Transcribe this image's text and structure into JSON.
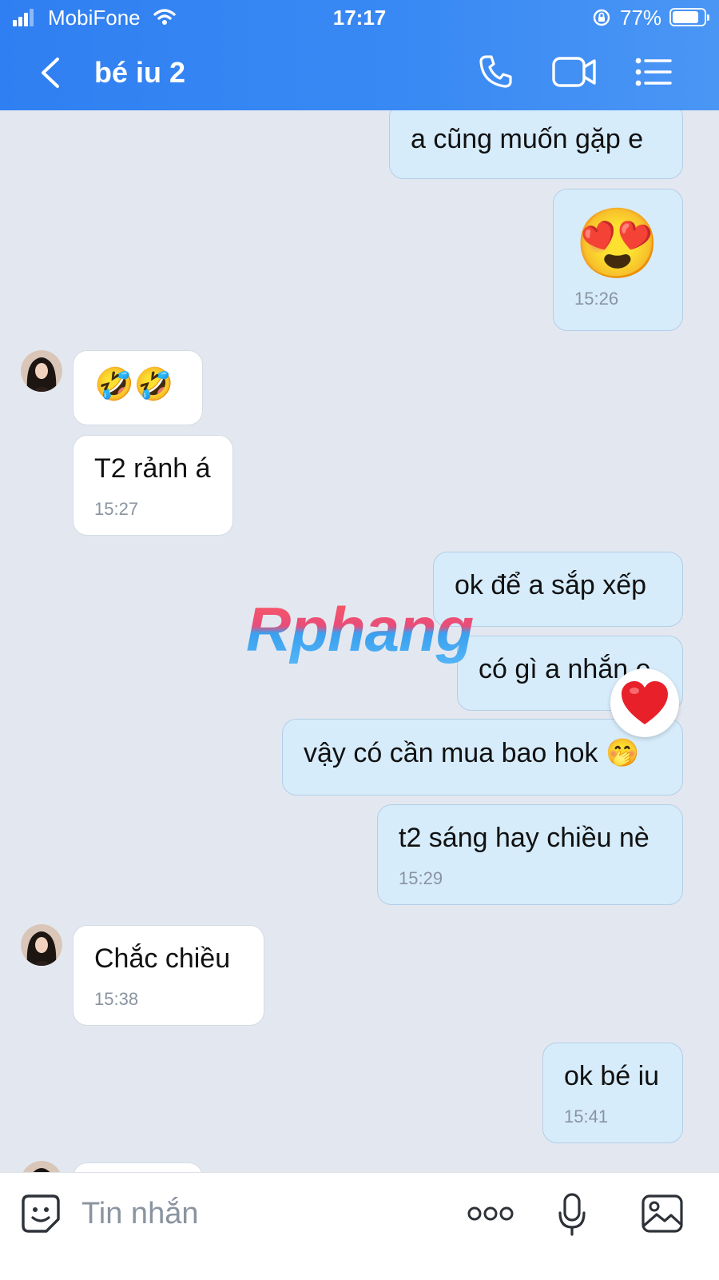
{
  "status_bar": {
    "carrier": "MobiFone",
    "time": "17:17",
    "battery": "77%"
  },
  "header": {
    "title": "bé iu 2"
  },
  "messages": [
    {
      "from": "me",
      "text": "a cũng muốn gặp e"
    },
    {
      "from": "me",
      "text": "😍",
      "time": "15:26"
    },
    {
      "from": "them",
      "text": "🤣🤣"
    },
    {
      "from": "them",
      "text": "T2 rảnh á",
      "time": "15:27"
    },
    {
      "from": "me",
      "text": "ok để a sắp xếp"
    },
    {
      "from": "me",
      "text": "có gì a nhắn e",
      "reaction": "❤️"
    },
    {
      "from": "me",
      "text": "vậy có cần mua bao hok 🤭"
    },
    {
      "from": "me",
      "text": "t2 sáng hay chiều nè",
      "time": "15:29"
    },
    {
      "from": "them",
      "text": "Chắc chiều",
      "time": "15:38"
    },
    {
      "from": "me",
      "text": "ok bé iu",
      "time": "15:41"
    }
  ],
  "watermark": "Rphang",
  "input": {
    "placeholder": "Tin nhắn"
  },
  "icons": [
    "back-icon",
    "phone-icon",
    "video-call-icon",
    "menu-icon",
    "sticker-icon",
    "more-icon",
    "mic-icon",
    "image-icon",
    "heart-reaction-icon",
    "avatar"
  ],
  "colors": {
    "header": "#3a8af4",
    "bubble_me": "#d6ecfb",
    "bubble_them": "#ffffff",
    "background": "#e3e8f0"
  }
}
